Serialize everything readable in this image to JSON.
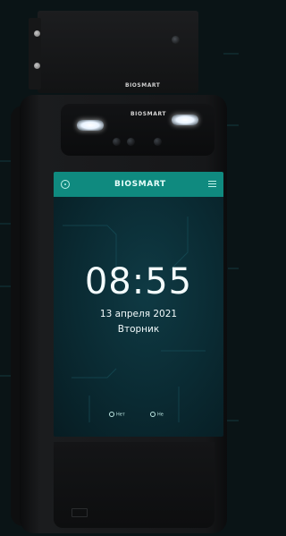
{
  "device": {
    "brand_top": "BIOSMART",
    "brand_band": "BIOSMART",
    "brand_screen": "BIOSMART"
  },
  "screen": {
    "time": "08:55",
    "date": "13 апреля 2021",
    "weekday": "Вторник",
    "status_left": "Нет",
    "status_right": "Не"
  },
  "colors": {
    "header": "#0f8a7f",
    "screen_bg": "#0a2a32",
    "background": "#0a1416"
  },
  "icons": [
    "settings-icon",
    "menu-icon",
    "wifi-icon",
    "user-icon"
  ]
}
